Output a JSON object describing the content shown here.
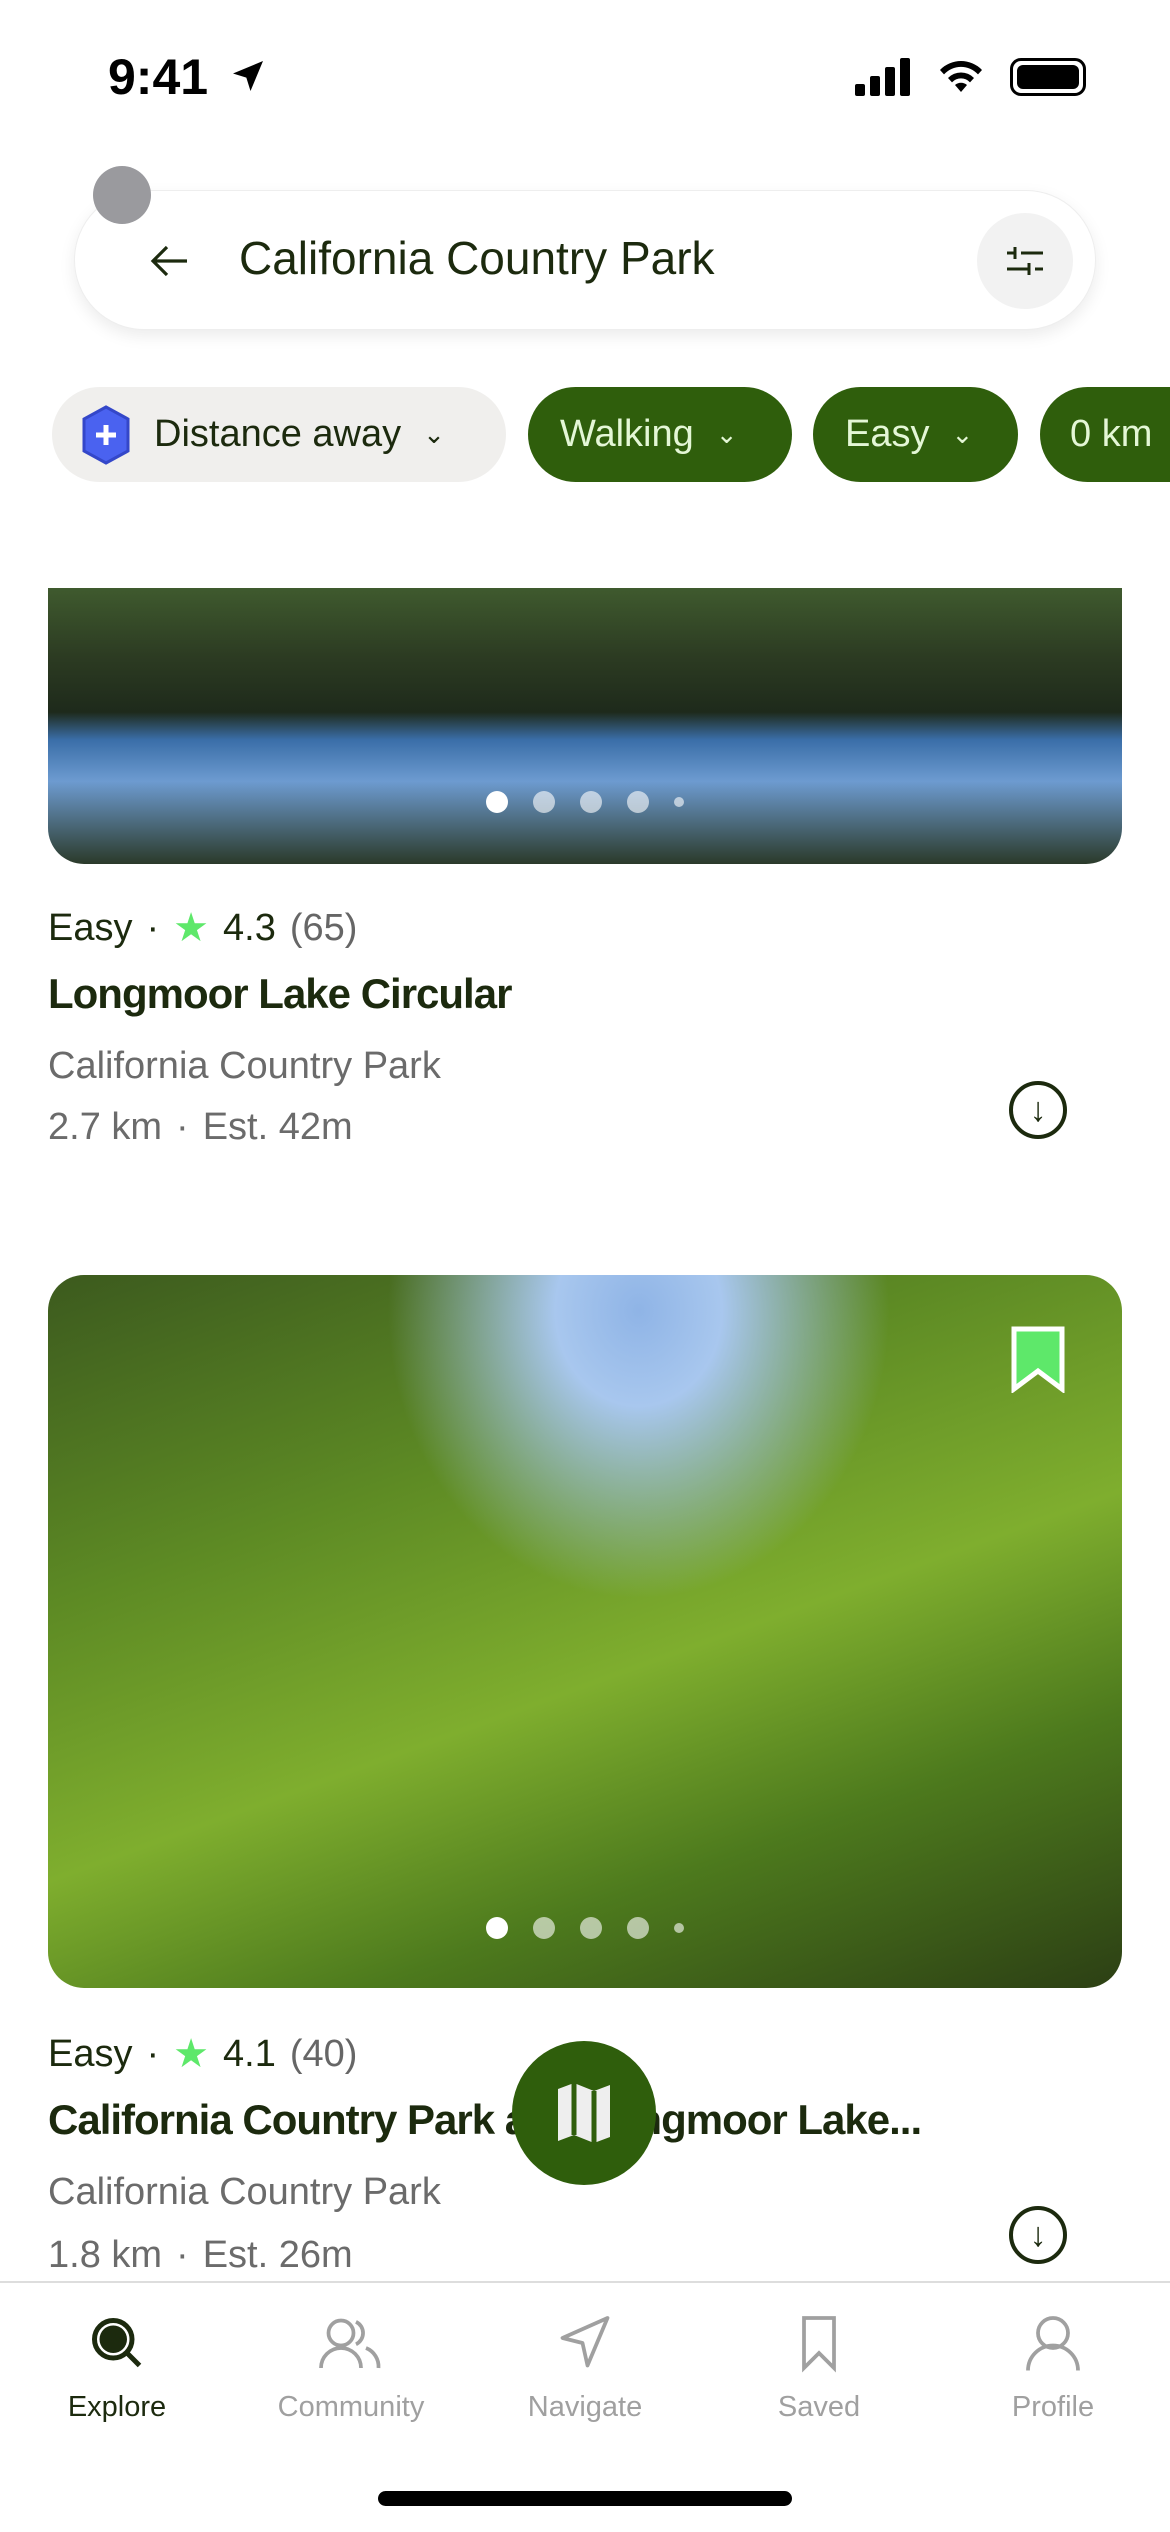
{
  "status_bar": {
    "time": "9:41"
  },
  "search": {
    "query": "California Country Park"
  },
  "filters": [
    {
      "label": "Distance away",
      "active": false
    },
    {
      "label": "Walking",
      "active": true
    },
    {
      "label": "Easy",
      "active": true
    },
    {
      "label": "0 km",
      "active": true
    }
  ],
  "trails": [
    {
      "difficulty": "Easy",
      "rating": "4.3",
      "reviews": "(65)",
      "name": "Longmoor Lake Circular",
      "park": "California Country Park",
      "distance": "2.7 km",
      "time": "Est. 42m",
      "photo_index": 0,
      "photo_count": 5
    },
    {
      "difficulty": "Easy",
      "rating": "4.1",
      "reviews": "(40)",
      "name": "California Country Park and Longmoor Lake...",
      "park": "California Country Park",
      "distance": "1.8 km",
      "time": "Est. 26m",
      "photo_index": 0,
      "photo_count": 5,
      "saved": true
    }
  ],
  "tabs": [
    {
      "label": "Explore",
      "icon": "search-icon",
      "active": true
    },
    {
      "label": "Community",
      "icon": "community-icon"
    },
    {
      "label": "Navigate",
      "icon": "navigate-icon"
    },
    {
      "label": "Saved",
      "icon": "bookmark-icon"
    },
    {
      "label": "Profile",
      "icon": "profile-icon"
    }
  ],
  "colors": {
    "brand_green": "#2f5e0c",
    "star": "#5ee86a",
    "text": "#1c2a0e"
  },
  "sep": "·"
}
